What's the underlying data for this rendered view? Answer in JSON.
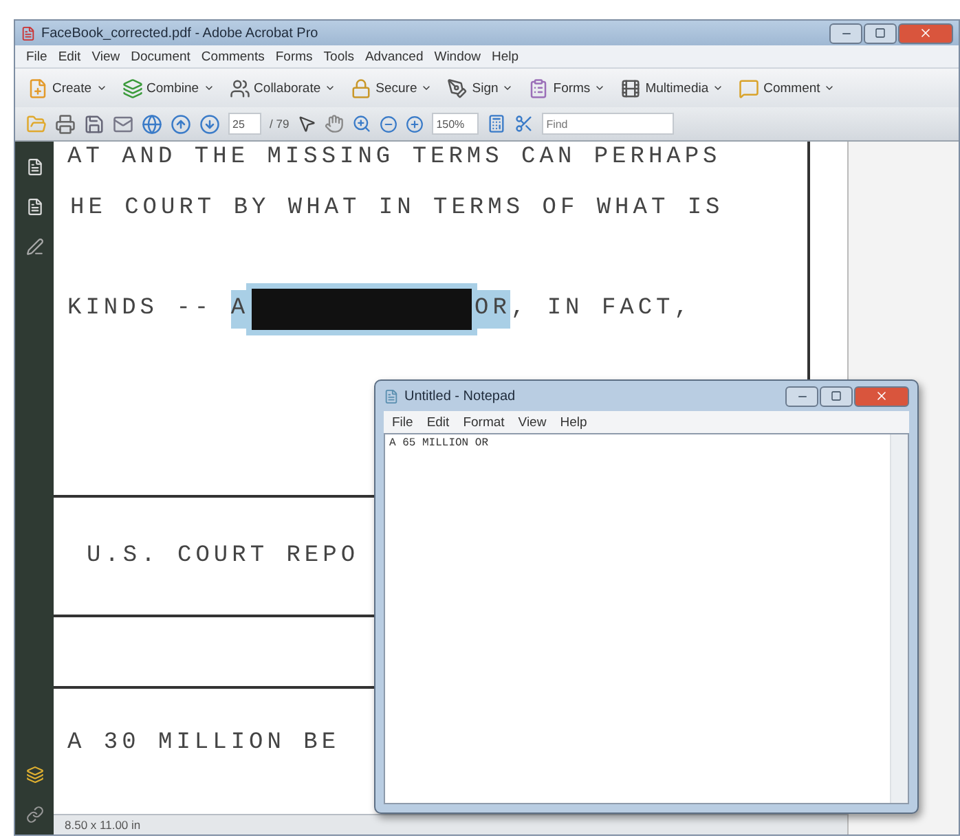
{
  "window": {
    "title": "FaceBook_corrected.pdf - Adobe Acrobat Pro"
  },
  "menu": [
    "File",
    "Edit",
    "View",
    "Document",
    "Comments",
    "Forms",
    "Tools",
    "Advanced",
    "Window",
    "Help"
  ],
  "tasks": [
    {
      "label": "Create",
      "kind": "create"
    },
    {
      "label": "Combine",
      "kind": "combine"
    },
    {
      "label": "Collaborate",
      "kind": "collaborate"
    },
    {
      "label": "Secure",
      "kind": "secure"
    },
    {
      "label": "Sign",
      "kind": "sign"
    },
    {
      "label": "Forms",
      "kind": "forms"
    },
    {
      "label": "Multimedia",
      "kind": "multimedia"
    },
    {
      "label": "Comment",
      "kind": "comment"
    }
  ],
  "toolbar": {
    "page": "25",
    "page_total": "/ 79",
    "zoom": "150%",
    "find_placeholder": "Find"
  },
  "document": {
    "lines": [
      {
        "segments": [
          {
            "kind": "text",
            "text": "AT AND THE MISSING TERMS CAN PERHAPS",
            "selected": false
          }
        ]
      },
      {
        "segments": [
          {
            "kind": "text",
            "text": "HE COURT BY WHAT IN TERMS OF WHAT IS",
            "selected": false
          }
        ]
      },
      {
        "segments": [
          {
            "kind": "text",
            "text": "KINDS -- ",
            "selected": false
          },
          {
            "kind": "text",
            "text": "A",
            "selected": true
          },
          {
            "kind": "redaction",
            "selected": true
          },
          {
            "kind": "text",
            "text": "OR",
            "selected": true
          },
          {
            "kind": "text",
            "text": ", IN FACT,",
            "selected": false
          }
        ]
      },
      {
        "segments": [
          {
            "kind": "text",
            "text": "U.S. COURT REPO",
            "selected": false
          }
        ]
      },
      {
        "segments": [
          {
            "kind": "text",
            "text": "A 30 MILLION BE",
            "selected": false
          }
        ]
      }
    ]
  },
  "status_bar": {
    "page_size": "8.50 x 11.00 in"
  },
  "notepad": {
    "title": "Untitled - Notepad",
    "menu": [
      "File",
      "Edit",
      "Format",
      "View",
      "Help"
    ],
    "text": "A 65 MILLION OR"
  }
}
